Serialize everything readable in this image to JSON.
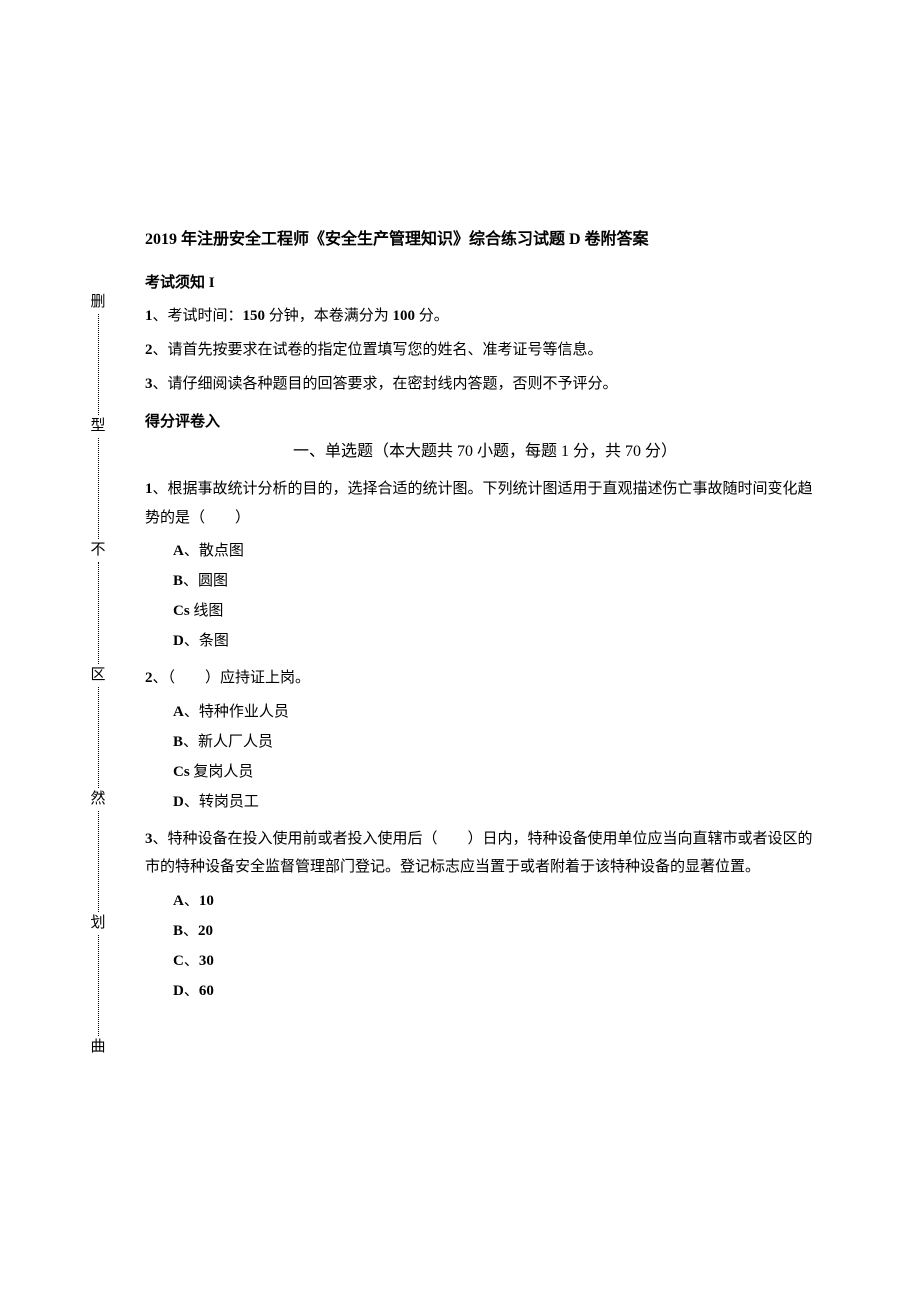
{
  "margin": {
    "chars": [
      "删",
      "型",
      "不",
      "区",
      "然",
      "划",
      "曲"
    ]
  },
  "title": "2019 年注册安全工程师《安全生产管理知识》综合练习试题 D 卷附答案",
  "notice": {
    "heading": "考试须知 I",
    "rules": [
      {
        "num": "1",
        "text": "、考试时间：",
        "bold1": "150",
        "mid": " 分钟，本卷满分为 ",
        "bold2": "100",
        "suffix": " 分。"
      },
      {
        "num": "2",
        "text": "、请首先按要求在试卷的指定位置填写您的姓名、准考证号等信息。"
      },
      {
        "num": "3",
        "text": "、请仔细阅读各种题目的回答要求，在密封线内答题，否则不予评分。"
      }
    ]
  },
  "scoring_label": "得分评卷入",
  "part_heading": "一、单选题（本大题共 70 小题，每题 1 分，共 70 分）",
  "questions": [
    {
      "num": "1",
      "stem": "、根据事故统计分析的目的，选择合适的统计图。下列统计图适用于直观描述伤亡事故随时间变化趋势的是（　　）",
      "options": [
        {
          "letter": "A",
          "sep": "、",
          "text": "散点图"
        },
        {
          "letter": "B",
          "sep": "、",
          "text": "圆图"
        },
        {
          "letter": "Cs",
          "sep": " ",
          "text": "线图"
        },
        {
          "letter": "D",
          "sep": "、",
          "text": "条图"
        }
      ]
    },
    {
      "num": "2",
      "stem": "、（　　）应持证上岗。",
      "options": [
        {
          "letter": "A",
          "sep": "、",
          "text": "特种作业人员"
        },
        {
          "letter": "B",
          "sep": "、",
          "text": "新人厂人员"
        },
        {
          "letter": "Cs",
          "sep": " ",
          "text": "复岗人员"
        },
        {
          "letter": "D",
          "sep": "、",
          "text": "转岗员工"
        }
      ]
    },
    {
      "num": "3",
      "stem": "、特种设备在投入使用前或者投入使用后（　　）日内，特种设备使用单位应当向直辖市或者设区的市的特种设备安全监督管理部门登记。登记标志应当置于或者附着于该特种设备的显著位置。",
      "options": [
        {
          "letter": "A",
          "sep": "、",
          "text": "10"
        },
        {
          "letter": "B",
          "sep": "、",
          "text": "20"
        },
        {
          "letter": "C",
          "sep": "、",
          "text": "30"
        },
        {
          "letter": "D",
          "sep": "、",
          "text": "60"
        }
      ]
    }
  ]
}
